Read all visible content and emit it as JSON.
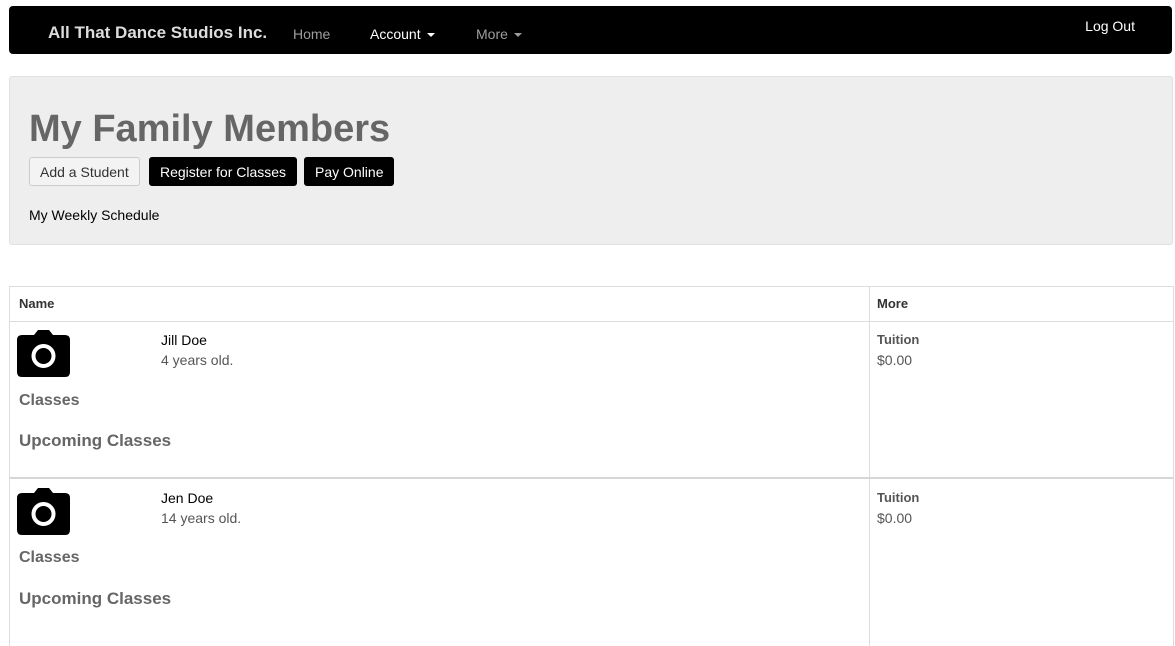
{
  "navbar": {
    "brand": "All That Dance Studios Inc.",
    "items": [
      {
        "label": "Home"
      },
      {
        "label": "Account"
      },
      {
        "label": "More"
      }
    ],
    "logout": "Log Out"
  },
  "jumbotron": {
    "title": "My Family Members",
    "buttons": {
      "add_student": "Add a Student",
      "register": "Register for Classes",
      "pay_online": "Pay Online"
    },
    "schedule_link": "My Weekly Schedule"
  },
  "table": {
    "headers": {
      "name": "Name",
      "more": "More"
    },
    "students": [
      {
        "name": "Jill Doe",
        "age": "4 years old.",
        "classes_label": "Classes",
        "upcoming_label": "Upcoming Classes",
        "tuition_label": "Tuition",
        "tuition_value": "$0.00",
        "photo_icon": "camera-icon"
      },
      {
        "name": "Jen Doe",
        "age": "14 years old.",
        "classes_label": "Classes",
        "upcoming_label": "Upcoming Classes",
        "tuition_label": "Tuition",
        "tuition_value": "$0.00",
        "photo_icon": "camera-icon"
      }
    ]
  },
  "colors": {
    "navbar_bg": "#000000",
    "jumbotron_bg": "#eeeeee",
    "primary_button": "#000000"
  }
}
